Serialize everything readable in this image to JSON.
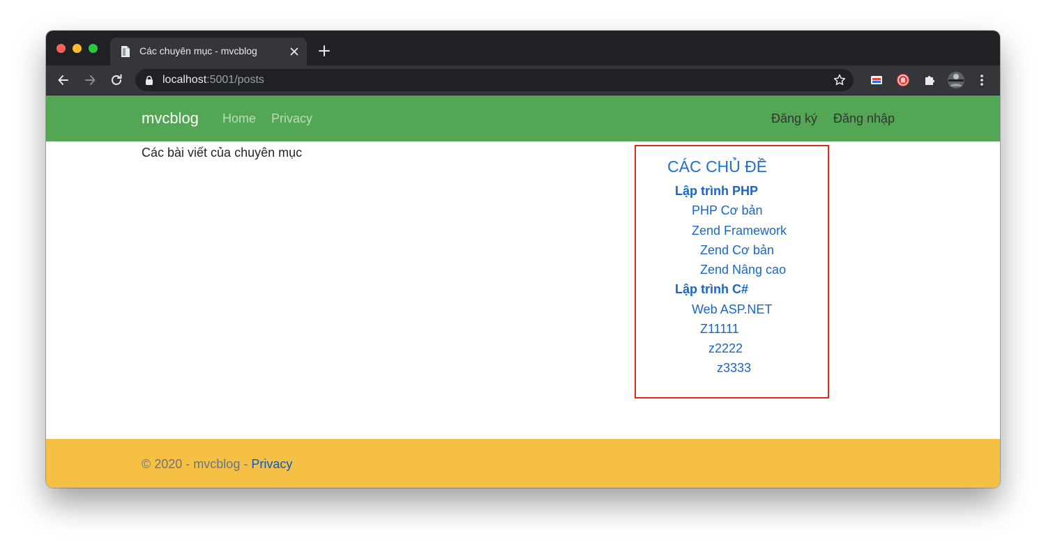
{
  "browser": {
    "tab": {
      "title": "Các chuyên mục - mvcblog"
    },
    "address": {
      "host": "localhost",
      "rest": ":5001/posts"
    }
  },
  "navbar": {
    "brand": "mvcblog",
    "links": [
      "Home",
      "Privacy"
    ],
    "right_links": [
      "Đăng ký",
      "Đăng nhập"
    ],
    "background": "#53a653"
  },
  "main": {
    "heading": "Các bài viết của chuyên mục"
  },
  "sidebar": {
    "title": "CÁC CHỦ ĐỀ",
    "categories": [
      {
        "label": "Lập trình PHP",
        "level": 0
      },
      {
        "label": "PHP Cơ bản",
        "level": 1
      },
      {
        "label": "Zend Framework",
        "level": 1
      },
      {
        "label": "Zend Cơ bản",
        "level": 2
      },
      {
        "label": "Zend Nâng cao",
        "level": 2
      },
      {
        "label": "Lập trình C#",
        "level": 0
      },
      {
        "label": "Web ASP.NET",
        "level": 1
      },
      {
        "label": "Z11111",
        "level": 2
      },
      {
        "label": "z2222",
        "level": 3
      },
      {
        "label": "z3333",
        "level": 4
      }
    ],
    "border_color": "#dd2a1e"
  },
  "footer": {
    "text": "© 2020 - mvcblog - ",
    "link": "Privacy",
    "background": "#f5c044"
  }
}
